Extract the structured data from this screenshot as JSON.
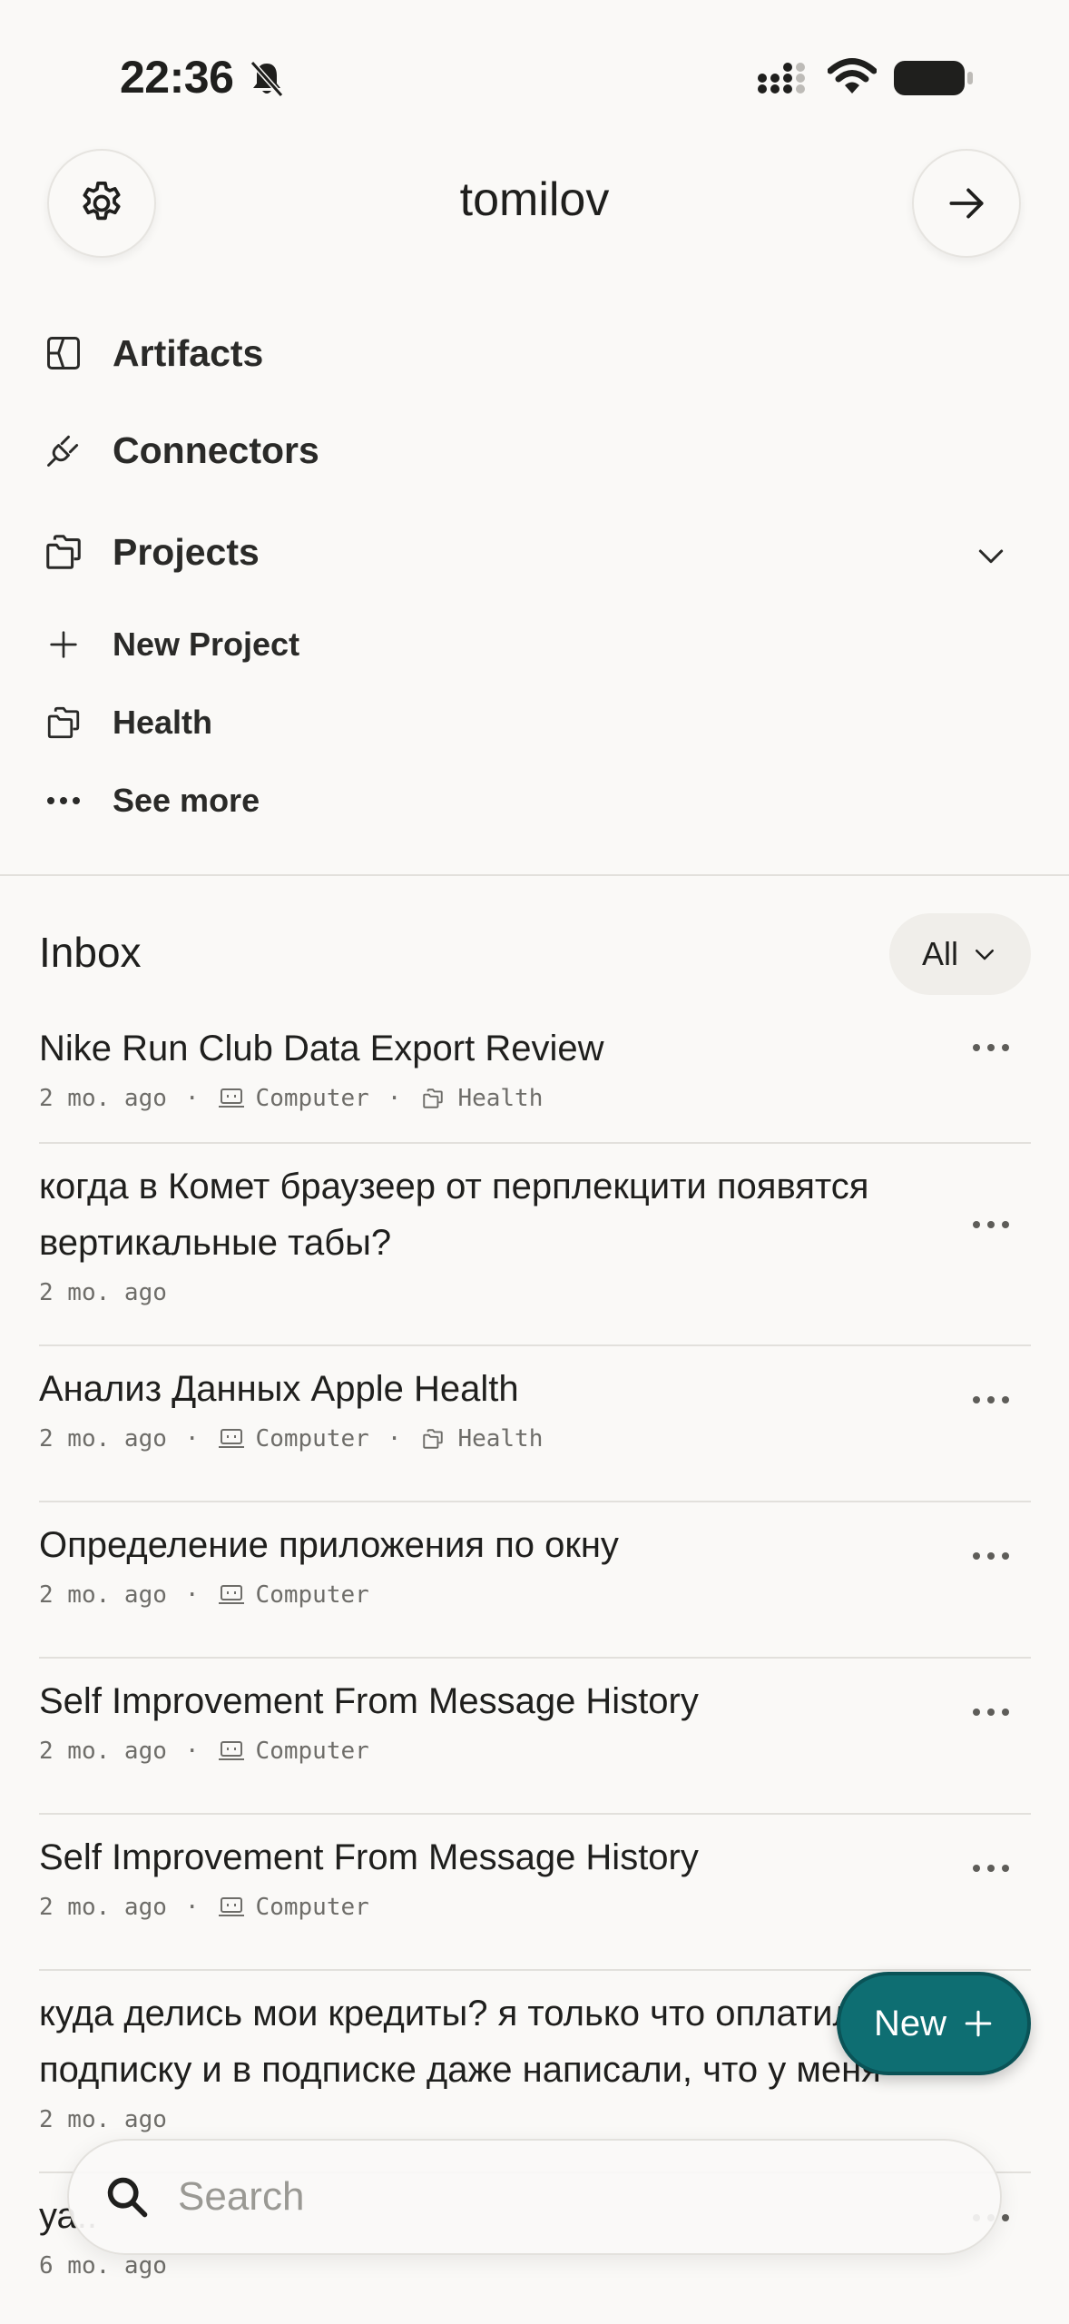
{
  "status_bar": {
    "time": "22:36",
    "icons": [
      "bell-slash-icon",
      "cellular-signal-icon",
      "wifi-icon",
      "battery-icon"
    ]
  },
  "header": {
    "account_name": "tomilov",
    "left_icon": "gear-icon",
    "right_icon": "arrow-right-icon"
  },
  "nav": {
    "artifacts": "Artifacts",
    "connectors": "Connectors",
    "projects": "Projects",
    "new_project": "New Project",
    "health": "Health",
    "see_more": "See more"
  },
  "inbox": {
    "title": "Inbox",
    "filter": "All",
    "items": [
      {
        "title": "Nike Run Club Data Export Review",
        "age": "2 mo. ago",
        "source": "Computer",
        "project": "Health"
      },
      {
        "title": "когда в Комет браузеер от перплекцити появятся вертикальные табы?",
        "age": "2 mo. ago"
      },
      {
        "title": "Анализ Данных Apple Health",
        "age": "2 mo. ago",
        "source": "Computer",
        "project": "Health"
      },
      {
        "title": "Определение приложения по окну",
        "age": "2 mo. ago",
        "source": "Computer"
      },
      {
        "title": "Self Improvement From Message History",
        "age": "2 mo. ago",
        "source": "Computer"
      },
      {
        "title": "Self Improvement From Message History",
        "age": "2 mo. ago",
        "source": "Computer"
      },
      {
        "title": "куда делись мои кредиты? я только что оплатил подписку и в подписке даже написали, что у меня",
        "age": "2 mo. ago"
      },
      {
        "title": "уа..",
        "age": "6 mo. ago"
      }
    ]
  },
  "fab": {
    "label": "New",
    "icon": "plus-icon",
    "color": "#0E6E72"
  },
  "search": {
    "placeholder": "Search",
    "icon": "search-icon"
  }
}
